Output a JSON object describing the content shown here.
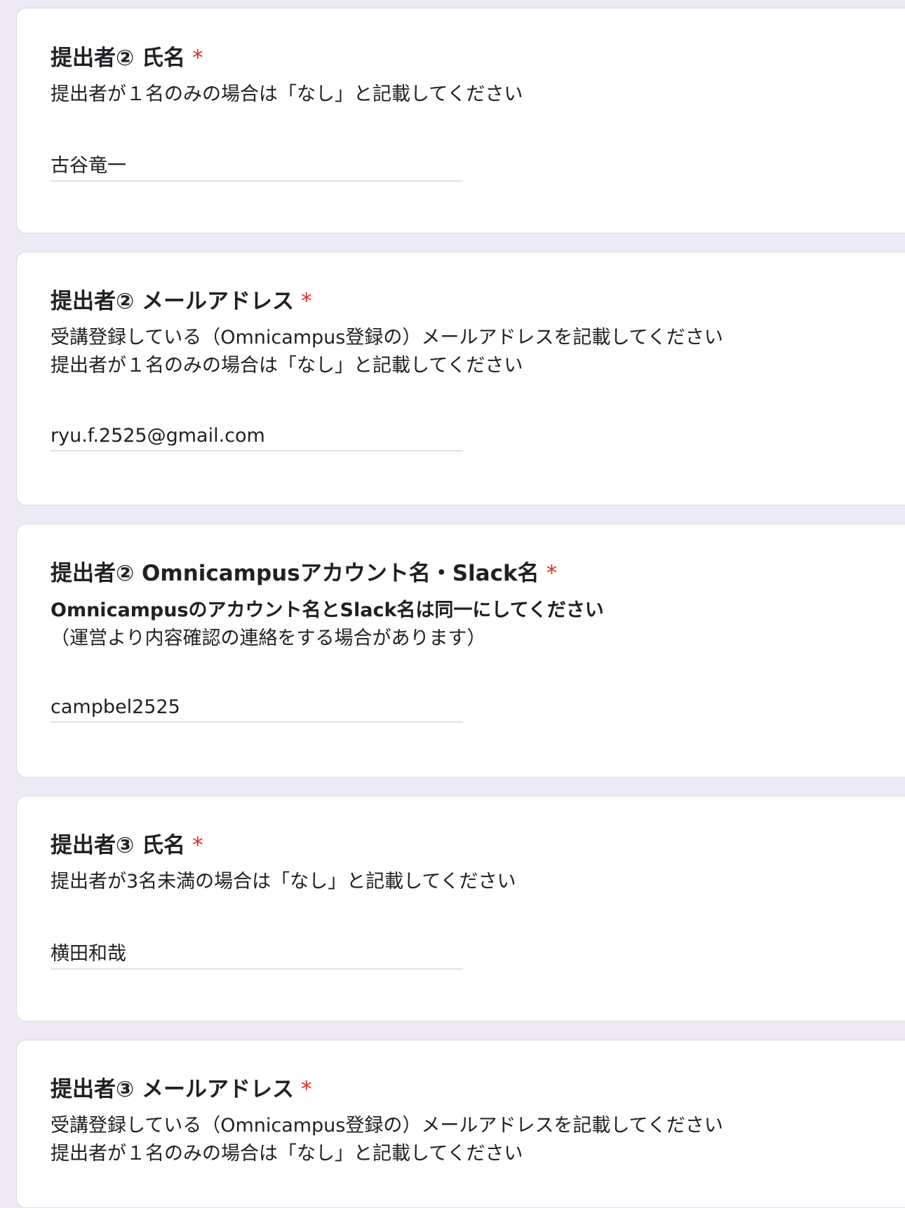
{
  "questions": [
    {
      "title": "提出者② 氏名",
      "required_mark": "*",
      "description_lines": [
        "提出者が１名のみの場合は「なし」と記載してください"
      ],
      "answer": "古谷竜一"
    },
    {
      "title": "提出者② メールアドレス",
      "required_mark": "*",
      "description_lines": [
        "受講登録している（Omnicampus登録の）メールアドレスを記載してください",
        "提出者が１名のみの場合は「なし」と記載してください"
      ],
      "answer": "ryu.f.2525@gmail.com"
    },
    {
      "title": "提出者② Omnicampusアカウント名・Slack名",
      "required_mark": "*",
      "description_bold": "Omnicampusのアカウント名とSlack名は同一にしてください",
      "description_lines": [
        "（運営より内容確認の連絡をする場合があります）"
      ],
      "answer": "campbel2525"
    },
    {
      "title": "提出者③ 氏名",
      "required_mark": "*",
      "description_lines": [
        "提出者が3名未満の場合は「なし」と記載してください"
      ],
      "answer": "横田和哉"
    },
    {
      "title": "提出者③ メールアドレス",
      "required_mark": "*",
      "description_lines": [
        "受講登録している（Omnicampus登録の）メールアドレスを記載してください",
        "提出者が１名のみの場合は「なし」と記載してください"
      ]
    }
  ]
}
